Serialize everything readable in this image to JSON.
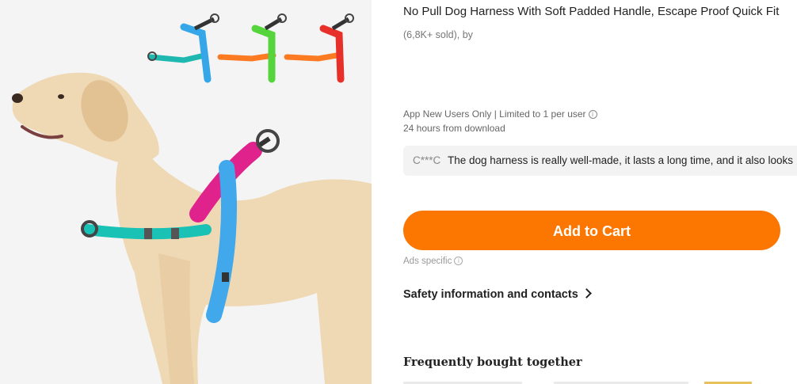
{
  "product": {
    "title": "No Pull Dog Harness With Soft Padded Handle, Escape Proof Quick Fit",
    "sold": "(6,8K+ sold), by",
    "image_alt": "Yellow labrador wearing a turquoise and pink padded no-pull harness, with three color variants shown above"
  },
  "promo": {
    "line1": "App New Users Only | Limited to 1 per user",
    "line2": "24 hours from download",
    "info_icon": "info-circle-icon"
  },
  "review": {
    "user": "C***C",
    "text": "The dog harness is really well-made, it lasts a long time, and it also looks"
  },
  "actions": {
    "add_to_cart_label": "Add to Cart",
    "ads_label": "Ads specific"
  },
  "links": {
    "safety_label": "Safety information and contacts"
  },
  "sections": {
    "frequently_bought_title": "Frequently bought together"
  },
  "colors": {
    "accent": "#fb7701",
    "review_bg": "#f3f3f3",
    "muted_text": "#777777"
  }
}
